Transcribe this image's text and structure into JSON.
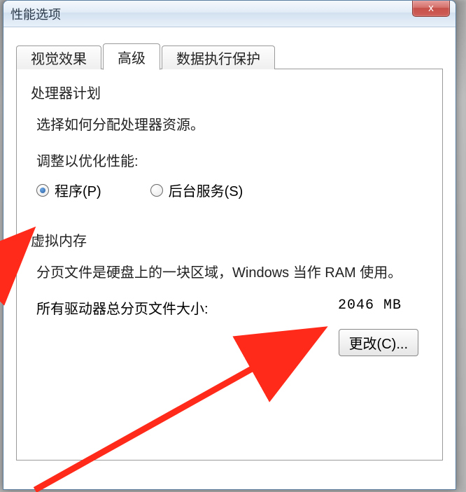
{
  "window": {
    "title": "性能选项",
    "close_glyph": "x"
  },
  "tabs": {
    "visual": "视觉效果",
    "advanced": "高级",
    "dep": "数据执行保护"
  },
  "processor": {
    "title": "处理器计划",
    "desc": "选择如何分配处理器资源。",
    "adjust_label": "调整以优化性能:",
    "programs": "程序(P)",
    "services": "后台服务(S)"
  },
  "vmem": {
    "title": "虚拟内存",
    "desc": "分页文件是硬盘上的一块区域，Windows 当作 RAM 使用。",
    "total_label": "所有驱动器总分页文件大小:",
    "total_value": "2046 MB",
    "change_btn": "更改(C)..."
  }
}
